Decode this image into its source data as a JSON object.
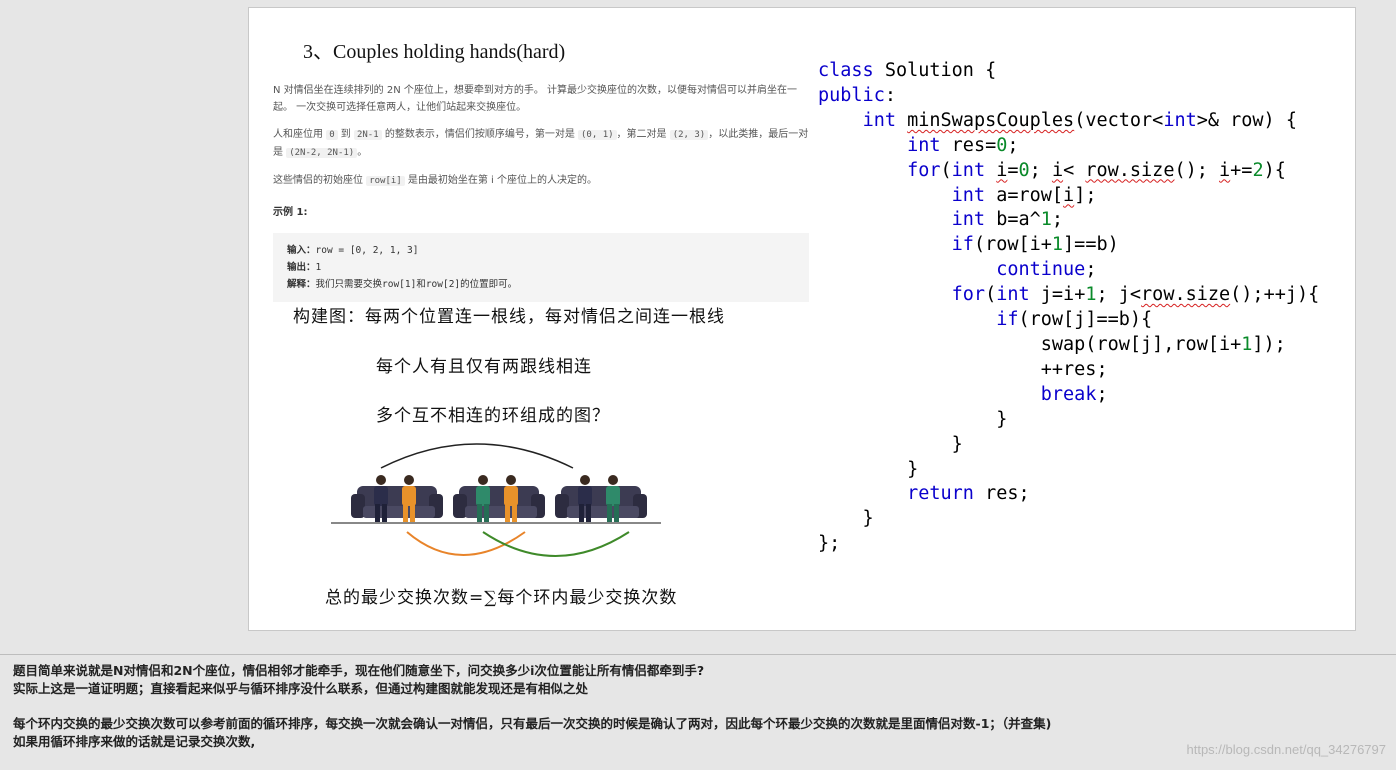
{
  "slide": {
    "title": "3、Couples holding hands(hard)",
    "problem": {
      "p1": "N 对情侣坐在连续排列的 2N 个座位上，想要牵到对方的手。 计算最少交换座位的次数，以便每对情侣可以并肩坐在一起。 一次交换可选择任意两人，让他们站起来交换座位。",
      "p2_pre": "人和座位用 ",
      "p2_c1": "0",
      "p2_mid1": " 到 ",
      "p2_c2": "2N-1",
      "p2_mid2": " 的整数表示，情侣们按顺序编号，第一对是 ",
      "p2_c3": "(0, 1)",
      "p2_mid3": "，第二对是 ",
      "p2_c4": "(2, 3)",
      "p2_mid4": "，以此类推，最后一对是 ",
      "p2_c5": "(2N-2, 2N-1)",
      "p2_end": "。",
      "p3_pre": "这些情侣的初始座位 ",
      "p3_c1": "row[i]",
      "p3_end": " 是由最初始坐在第 i 个座位上的人决定的。",
      "example_title": "示例 1:",
      "ex_input_label": "输入：",
      "ex_input": "row = [0, 2, 1, 3]",
      "ex_output_label": "输出：",
      "ex_output": "1",
      "ex_explain_label": "解释：",
      "ex_explain": "我们只需要交换row[1]和row[2]的位置即可。"
    },
    "notes": {
      "n1": "构建图：每两个位置连一根线，每对情侣之间连一根线",
      "n2": "每个人有且仅有两跟线相连",
      "n3": "多个互不相连的环组成的图？",
      "n4": "总的最少交换次数=∑每个环内最少交换次数"
    },
    "colors": {
      "arc_top": "#222222",
      "arc_orange": "#e8842a",
      "arc_green": "#3f8a2a",
      "sofa": "#3c3b52"
    }
  },
  "code": {
    "l1_kw": "class",
    "l1_rest": " Solution {",
    "l2_kw": "public",
    "l2_rest": ":",
    "l3_indent": "    ",
    "l3_kw": "int",
    "l3_sp": " ",
    "l3_fn": "minSwapsCouples",
    "l3_a": "(vector<",
    "l3_kw2": "int",
    "l3_b": ">& row) {",
    "l4_indent": "        ",
    "l4_kw": "int",
    "l4_a": " res=",
    "l4_num": "0",
    "l4_b": ";",
    "l5_indent": "        ",
    "l5_kw": "for",
    "l5_a": "(",
    "l5_kw2": "int",
    "l5_b": " ",
    "l5_i1": "i",
    "l5_c": "=",
    "l5_num": "0",
    "l5_d": "; ",
    "l5_i2": "i",
    "l5_e": "< ",
    "l5_rs": "row.size",
    "l5_f": "(); ",
    "l5_i3": "i",
    "l5_g": "+=",
    "l5_num2": "2",
    "l5_h": "){",
    "l6_indent": "            ",
    "l6_kw": "int",
    "l6_a": " a=row[",
    "l6_i": "i",
    "l6_b": "];",
    "l7_indent": "            ",
    "l7_kw": "int",
    "l7_a": " b=a^",
    "l7_num": "1",
    "l7_b": ";",
    "l8_indent": "            ",
    "l8_kw": "if",
    "l8_a": "(row[i+",
    "l8_num": "1",
    "l8_b": "]==b)",
    "l9_indent": "                ",
    "l9_kw": "continue",
    "l9_b": ";",
    "l10_indent": "            ",
    "l10_kw": "for",
    "l10_a": "(",
    "l10_kw2": "int",
    "l10_b": " j=i+",
    "l10_num": "1",
    "l10_c": "; j<",
    "l10_rs": "row.size",
    "l10_d": "();++j){",
    "l11_indent": "                ",
    "l11_kw": "if",
    "l11_a": "(row[j]==b){",
    "l12": "                    swap(row[j],row[i+",
    "l12_num": "1",
    "l12_b": "]);",
    "l13": "                    ++res;",
    "l14_indent": "                    ",
    "l14_kw": "break",
    "l14_b": ";",
    "l15": "                }",
    "l16": "            }",
    "l17": "        }",
    "l18_indent": "        ",
    "l18_kw": "return",
    "l18_b": " res;",
    "l19": "    }",
    "l20": "};"
  },
  "footer": {
    "line1": "题目简单来说就是N对情侣和2N个座位，情侣相邻才能牵手，现在他们随意坐下，问交换多少i次位置能让所有情侣都牵到手?",
    "line2": "实际上这是一道证明题；直接看起来似乎与循环排序没什么联系，但通过构建图就能发现还是有相似之处",
    "line3": "每个环内交换的最少交换次数可以参考前面的循环排序，每交换一次就会确认一对情侣，只有最后一次交换的时候是确认了两对，因此每个环最少交换的次数就是里面情侣对数-1；（并查集)",
    "line4": "如果用循环排序来做的话就是记录交换次数,"
  },
  "watermark": "https://blog.csdn.net/qq_34276797"
}
